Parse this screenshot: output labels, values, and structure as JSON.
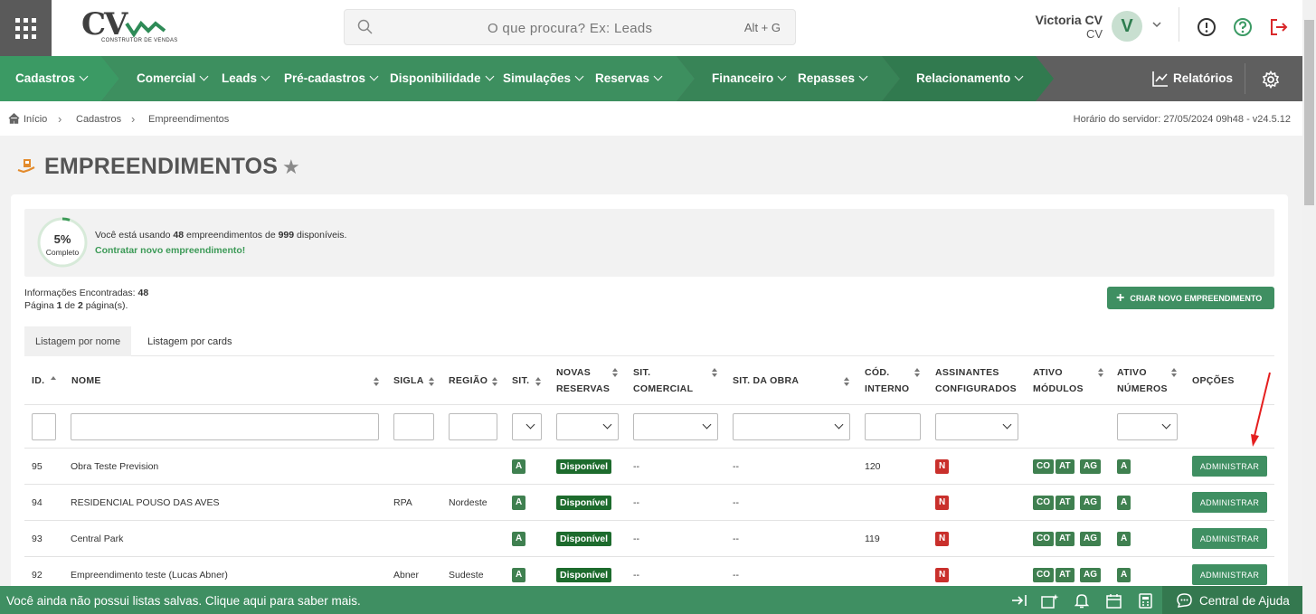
{
  "header": {
    "search_placeholder": "O que procura? Ex: Leads",
    "search_shortcut": "Alt + G",
    "user_name": "Victoria CV",
    "user_org": "CV",
    "avatar_letter": "V",
    "logo_text": "CV",
    "logo_sub": "CONSTRUTOR DE VENDAS"
  },
  "nav": {
    "items": [
      "Cadastros",
      "Comercial",
      "Leads",
      "Pré-cadastros",
      "Disponibilidade",
      "Simulações",
      "Reservas",
      "Financeiro",
      "Repasses",
      "Relacionamento"
    ],
    "reports": "Relatórios",
    "colors": {
      "seg1": "#3b9a64",
      "seg2": "#3d8f5f",
      "seg3": "#388457",
      "seg4": "#317a4f",
      "gray": "#5f5f5f"
    }
  },
  "breadcrumb": {
    "home": "Início",
    "level1": "Cadastros",
    "level2": "Empreendimentos",
    "server": "Horário do servidor: 27/05/2024 09h48 - v24.5.12"
  },
  "page": {
    "title": "EMPREENDIMENTOS"
  },
  "usage": {
    "pct": "5%",
    "pct_value": 0.05,
    "completo": "Completo",
    "pre": "Você está usando ",
    "used": "48",
    "mid": " empreendimentos de ",
    "total": "999",
    "post": " disponíveis.",
    "link": "Contratar novo empreendimento!"
  },
  "info": {
    "found_label": "Informações Encontradas: ",
    "found": "48",
    "page_pre": "Página ",
    "page": "1",
    "page_mid": " de ",
    "pages": "2",
    "page_post": " página(s)."
  },
  "new_button": "CRIAR NOVO EMPREENDIMENTO",
  "tabs": [
    "Listagem por nome",
    "Listagem por cards"
  ],
  "columns": {
    "id": "ID.",
    "nome": "NOME",
    "sigla": "SIGLA",
    "regiao": "REGIÃO",
    "sit": "SIT.",
    "novas1": "NOVAS",
    "novas2": "RESERVAS",
    "sitcom1": "SIT.",
    "sitcom2": "COMERCIAL",
    "obra": "SIT. DA OBRA",
    "cod1": "CÓD.",
    "cod2": "INTERNO",
    "ass1": "ASSINANTES",
    "ass2": "CONFIGURADOS",
    "mod1": "ATIVO",
    "mod2": "MÓDULOS",
    "num1": "ATIVO",
    "num2": "NÚMEROS",
    "opcoes": "OPÇÕES"
  },
  "rows": [
    {
      "id": "95",
      "nome": "Obra Teste Prevision",
      "sigla": "",
      "regiao": "",
      "sit": "A",
      "novas": "Disponível",
      "sitcom": "--",
      "obra": "--",
      "cod": "120",
      "ass": "N",
      "mods": [
        "CO",
        "AT",
        "AG"
      ],
      "num": "A",
      "opt": "ADMINISTRAR"
    },
    {
      "id": "94",
      "nome": "RESIDENCIAL POUSO DAS AVES",
      "sigla": "RPA",
      "regiao": "Nordeste",
      "sit": "A",
      "novas": "Disponível",
      "sitcom": "--",
      "obra": "--",
      "cod": "",
      "ass": "N",
      "mods": [
        "CO",
        "AT",
        "AG"
      ],
      "num": "A",
      "opt": "ADMINISTRAR"
    },
    {
      "id": "93",
      "nome": "Central Park",
      "sigla": "",
      "regiao": "",
      "sit": "A",
      "novas": "Disponível",
      "sitcom": "--",
      "obra": "--",
      "cod": "119",
      "ass": "N",
      "mods": [
        "CO",
        "AT",
        "AG"
      ],
      "num": "A",
      "opt": "ADMINISTRAR"
    },
    {
      "id": "92",
      "nome": "Empreendimento teste (Lucas Abner)",
      "sigla": "Abner",
      "regiao": "Sudeste",
      "sit": "A",
      "novas": "Disponível",
      "sitcom": "--",
      "obra": "--",
      "cod": "",
      "ass": "N",
      "mods": [
        "CO",
        "AT",
        "AG"
      ],
      "num": "A",
      "opt": "ADMINISTRAR"
    }
  ],
  "bottom": {
    "message": "Você ainda não possui listas salvas. Clique aqui para saber mais.",
    "help": "Central de Ajuda"
  }
}
